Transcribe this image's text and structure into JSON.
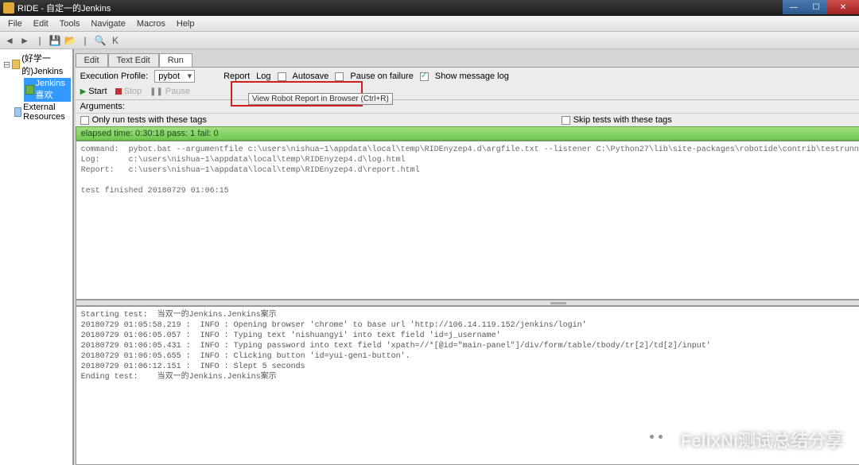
{
  "window": {
    "title": "RIDE - 自定一的Jenkins"
  },
  "menu": {
    "items": [
      "File",
      "Edit",
      "Tools",
      "Navigate",
      "Macros",
      "Help"
    ]
  },
  "toolbar_icons": [
    "back",
    "forward",
    "sep",
    "save",
    "save-all",
    "sep",
    "search",
    "cut",
    "copy",
    "paste"
  ],
  "sidebar": {
    "root": "(好学一的)Jenkins",
    "child": "Jenkins喜欢",
    "external": "External Resources"
  },
  "tabs": {
    "items": [
      "Edit",
      "Text Edit",
      "Run"
    ],
    "active": 2
  },
  "run": {
    "profile_label": "Execution Profile:",
    "profile_value": "pybot",
    "report_btn": "Report",
    "log_btn": "Log",
    "autosave": "Autosave",
    "pause_on_failure": "Pause on failure",
    "show_message_log": "Show message log",
    "start": "Start",
    "stop": "Stop",
    "pause": "Pause",
    "tooltip": "View Robot Report in Browser (Ctrl+R)",
    "arguments_label": "Arguments:",
    "only_tags": "Only run tests with these tags",
    "skip_tags": "Skip tests with these tags"
  },
  "status": {
    "text": "elapsed time: 0:30:18   pass: 1   fail: 0"
  },
  "output_top": "command:  pybot.bat --argumentfile c:\\users\\nishua~1\\appdata\\local\\temp\\RIDEnyzep4.d\\argfile.txt --listener C:\\Python27\\lib\\site-packages\\robotide\\contrib\\testrunner\\TestRunnerAgent.py:55102:False C:\\\nLog:      c:\\users\\nishua~1\\appdata\\local\\temp\\RIDEnyzep4.d\\log.html\nReport:   c:\\users\\nishua~1\\appdata\\local\\temp\\RIDEnyzep4.d\\report.html\n\ntest finished 20180729 01:06:15",
  "output_bottom": "Starting test:  当双一的Jenkins.Jenkins案示\n20180729 01:05:58.219 :  INFO : Opening browser 'chrome' to base url 'http://106.14.119.152/jenkins/login'\n20180729 01:06:05.057 :  INFO : Typing text 'nishuangyi' into text field 'id=j_username'\n20180729 01:06:05.431 :  INFO : Typing password into text field 'xpath=//*[@id=\"main-panel\"]/div/form/table/tbody/tr[2]/td[2]/input'\n20180729 01:06:05.655 :  INFO : Clicking button 'id=yui-gen1-button'.\n20180729 01:06:12.151 :  INFO : Slept 5 seconds\nEnding test:    当双一的Jenkins.Jenkins案示",
  "watermark": "FelixNi测试总结分享"
}
